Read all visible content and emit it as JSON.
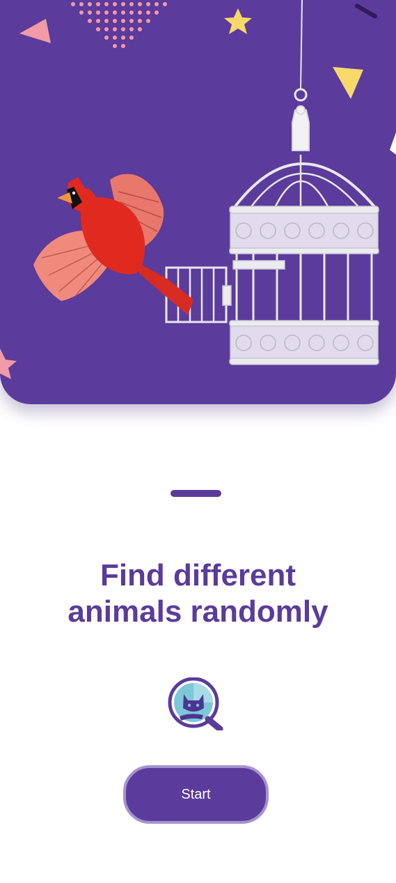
{
  "onboarding": {
    "headline_line1": "Find different",
    "headline_line2": "animals randomly",
    "start_label": "Start"
  },
  "colors": {
    "primary": "#5b3b9b",
    "button_border": "#a593cf",
    "cardinal_red": "#e02a1f",
    "confetti_pink": "#f29aa6",
    "confetti_yellow": "#f7d96a"
  },
  "icons": {
    "logo": "cat-magnifier-icon",
    "bird": "cardinal-bird-illustration",
    "cage": "birdcage-illustration"
  }
}
